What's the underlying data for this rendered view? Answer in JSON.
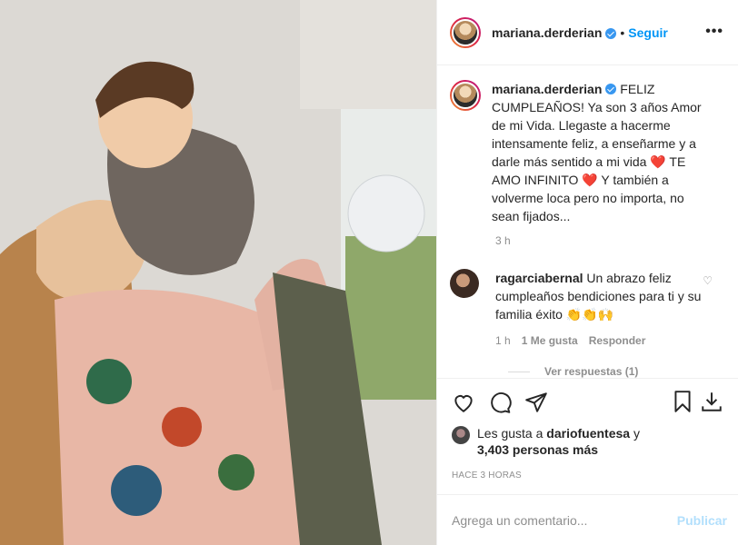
{
  "post": {
    "username": "mariana.derderian",
    "follow_label": "Seguir",
    "more_label": "•••"
  },
  "caption": {
    "username": "mariana.derderian",
    "text_1": "FELIZ CUMPLEAÑOS! Ya son 3 años Amor de mi Vida. Llegaste a hacerme intensamente feliz, a enseñarme y a darle más sentido a mi vida ",
    "text_2": " TE AMO INFINITO ",
    "text_3": " Y también a volverme loca pero no importa, no sean fijados...",
    "heart_emoji": "❤️",
    "time": "3 h"
  },
  "comment": {
    "username": "ragarciabernal",
    "text": "Un abrazo feliz cumpleaños bendiciones para ti y su familia éxito ",
    "emojis": "👏👏🙌",
    "time": "1 h",
    "likes": "1 Me gusta",
    "reply_label": "Responder",
    "view_replies": "Ver respuestas (1)"
  },
  "likes": {
    "prefix": "Les gusta a ",
    "user": "dariofuentesa",
    "mid": " y",
    "count": "3,403 personas más"
  },
  "timestamp": "HACE 3 HORAS",
  "add_comment": {
    "placeholder": "Agrega un comentario...",
    "publish_label": "Publicar"
  },
  "colors": {
    "accent": "#0095f6",
    "heart": "#ed4956"
  }
}
